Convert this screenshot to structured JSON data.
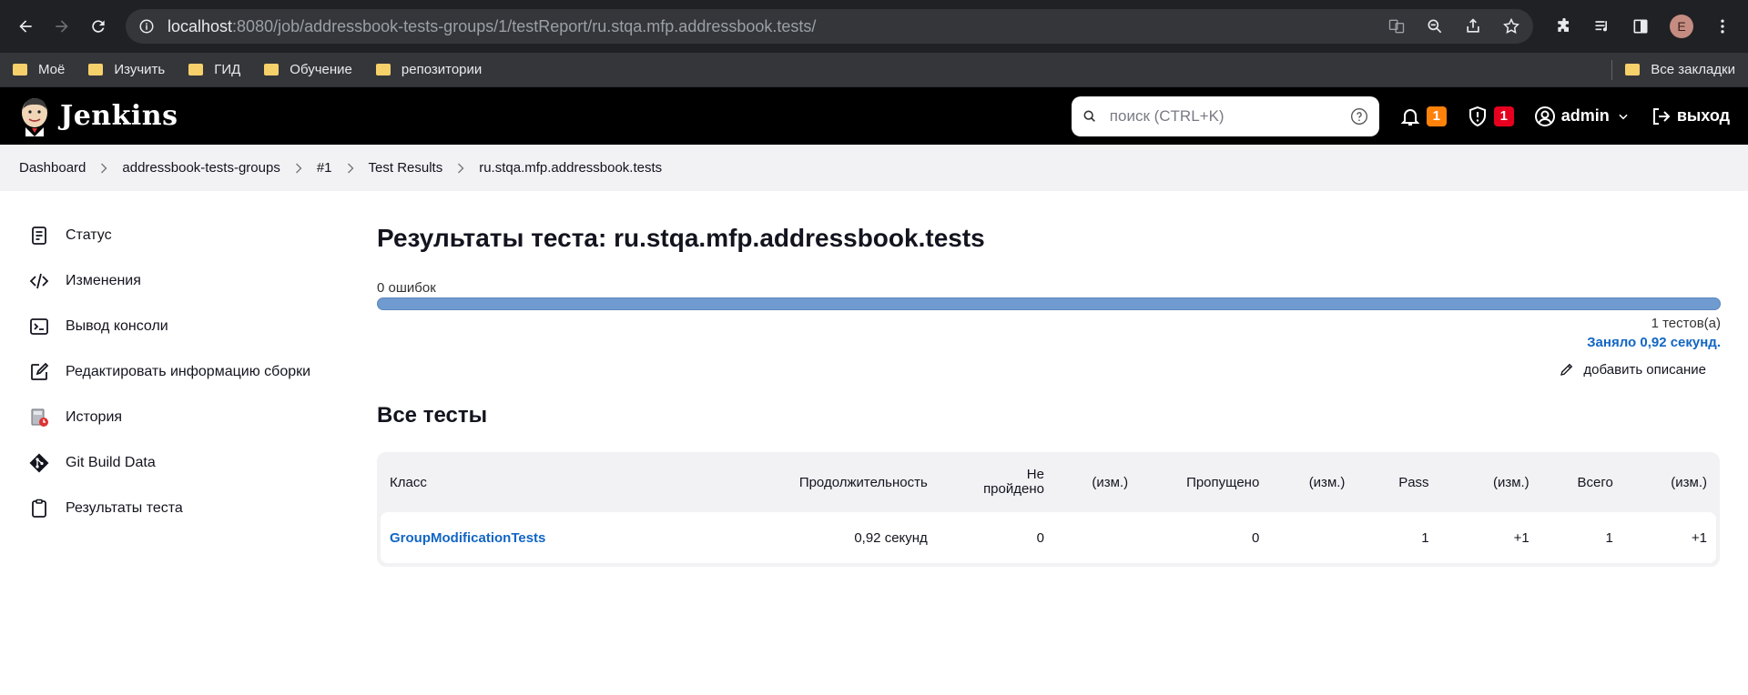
{
  "browser": {
    "url_host": "localhost",
    "url_rest": ":8080/job/addressbook-tests-groups/1/testReport/ru.stqa.mfp.addressbook.tests/",
    "profile_initial": "E",
    "bookmarks": [
      "Моё",
      "Изучить",
      "ГИД",
      "Обучение",
      "репозитории"
    ],
    "all_bookmarks": "Все закладки"
  },
  "header": {
    "logo_text": "Jenkins",
    "search_placeholder": "поиск (CTRL+K)",
    "notifications_count": "1",
    "security_count": "1",
    "user": "admin",
    "logout": "выход"
  },
  "breadcrumb": [
    "Dashboard",
    "addressbook-tests-groups",
    "#1",
    "Test Results",
    "ru.stqa.mfp.addressbook.tests"
  ],
  "sidebar": {
    "items": [
      {
        "label": "Статус",
        "icon": "status-icon"
      },
      {
        "label": "Изменения",
        "icon": "code-icon"
      },
      {
        "label": "Вывод консоли",
        "icon": "terminal-icon"
      },
      {
        "label": "Редактировать информацию сборки",
        "icon": "edit-icon"
      },
      {
        "label": "История",
        "icon": "history-icon"
      },
      {
        "label": "Git Build Data",
        "icon": "git-icon"
      },
      {
        "label": "Результаты теста",
        "icon": "clipboard-icon"
      }
    ]
  },
  "main": {
    "title": "Результаты теста: ru.stqa.mfp.addressbook.tests",
    "fail_text": "0 ошибок",
    "pass_fraction": 1.0,
    "tests_count": "1 тестов(а)",
    "took": "Заняло 0,92 секунд.",
    "add_description": "добавить описание",
    "all_tests_heading": "Все тесты"
  },
  "table": {
    "headers": [
      "Класс",
      "Продолжительность",
      "Не пройдено",
      "(изм.)",
      "Пропущено",
      "(изм.)",
      "Pass",
      "(изм.)",
      "Всего",
      "(изм.)"
    ],
    "rows": [
      {
        "class": "GroupModificationTests",
        "duration": "0,92 секунд",
        "failed": "0",
        "failed_diff": "",
        "skipped": "0",
        "skipped_diff": "",
        "pass": "1",
        "pass_diff": "+1",
        "total": "1",
        "total_diff": "+1"
      }
    ]
  },
  "colors": {
    "accent_link": "#1266c4",
    "progress": "#6f9bd0",
    "badge_orange": "#fe820a",
    "badge_red": "#e6001f"
  }
}
